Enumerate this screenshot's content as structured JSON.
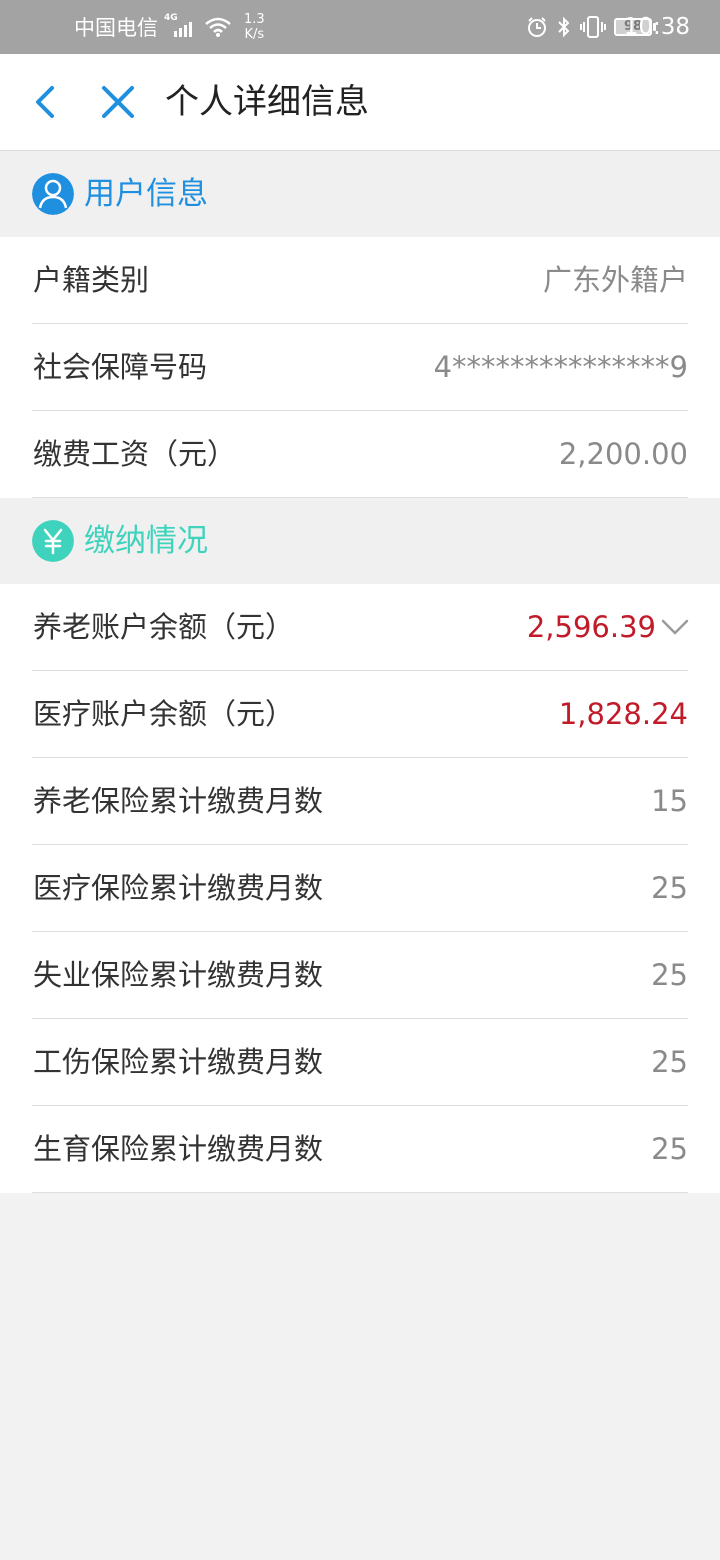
{
  "status_bar": {
    "carrier": "中国电信",
    "signal_badge": "4G",
    "net_speed_value": "1.3",
    "net_speed_unit": "K/s",
    "battery": "98",
    "time": "10:38"
  },
  "nav": {
    "title": "个人详细信息"
  },
  "user_section": {
    "title": "用户信息",
    "rows": [
      {
        "label": "户籍类别",
        "value": "广东外籍户"
      },
      {
        "label": "社会保障号码",
        "value": "4***************9"
      },
      {
        "label": "缴费工资（元）",
        "value": "2,200.00"
      }
    ]
  },
  "payment_section": {
    "title": "缴纳情况",
    "rows": [
      {
        "label": "养老账户余额（元）",
        "value": "2,596.39"
      },
      {
        "label": "医疗账户余额（元）",
        "value": "1,828.24"
      },
      {
        "label": "养老保险累计缴费月数",
        "value": "15"
      },
      {
        "label": "医疗保险累计缴费月数",
        "value": "25"
      },
      {
        "label": "失业保险累计缴费月数",
        "value": "25"
      },
      {
        "label": "工伤保险累计缴费月数",
        "value": "25"
      },
      {
        "label": "生育保险累计缴费月数",
        "value": "25"
      }
    ]
  },
  "colors": {
    "accent_blue": "#1f8fe0",
    "accent_teal": "#3fd3bd",
    "value_red": "#c11b2a",
    "status_bar_bg": "#a3a3a3"
  }
}
